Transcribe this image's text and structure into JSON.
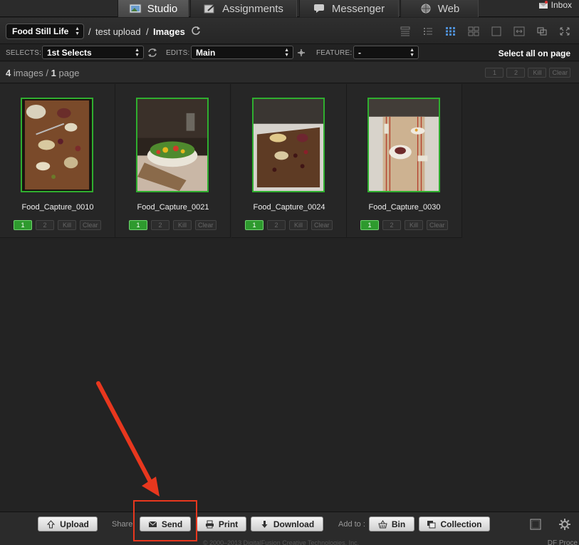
{
  "nav": {
    "tabs": [
      {
        "label": "Studio",
        "active": true,
        "icon": "photo-icon"
      },
      {
        "label": "Assignments",
        "active": false,
        "icon": "edit-icon"
      },
      {
        "label": "Messenger",
        "active": false,
        "icon": "chat-icon"
      },
      {
        "label": "Web",
        "active": false,
        "icon": "globe-icon"
      }
    ],
    "inbox_label": "Inbox"
  },
  "breadcrumb": {
    "project": "Food Still Life",
    "separator": "/",
    "folder": "test upload",
    "current": "Images"
  },
  "filters": {
    "selects_label": "SELECTS:",
    "selects_value": "1st Selects",
    "edits_label": "EDITS:",
    "edits_value": "Main",
    "feature_label": "FEATURE:",
    "feature_value": "-",
    "select_all_label": "Select all on page"
  },
  "counts": {
    "images_count": "4",
    "images_label": "images",
    "separator": "/",
    "pages_count": "1",
    "pages_label": "page"
  },
  "rating_buttons": {
    "one": "1",
    "two": "2",
    "kill": "Kill",
    "clear": "Clear"
  },
  "images": [
    {
      "name": "Food_Capture_0010",
      "rating": "1"
    },
    {
      "name": "Food_Capture_0021",
      "rating": "1"
    },
    {
      "name": "Food_Capture_0024",
      "rating": "1"
    },
    {
      "name": "Food_Capture_0030",
      "rating": "1"
    }
  ],
  "toolbar": {
    "upload": "Upload",
    "share_label": "Share",
    "send": "Send",
    "print": "Print",
    "download": "Download",
    "add_to_label": "Add to :",
    "bin": "Bin",
    "collection": "Collection"
  },
  "footer": {
    "copyright": "© 2000–2013 DigitalFusion Creative Technologies, Inc.",
    "right_text": "DF Proce"
  },
  "colors": {
    "accent_green": "#2fae2f",
    "annotation_red": "#e8371e"
  }
}
